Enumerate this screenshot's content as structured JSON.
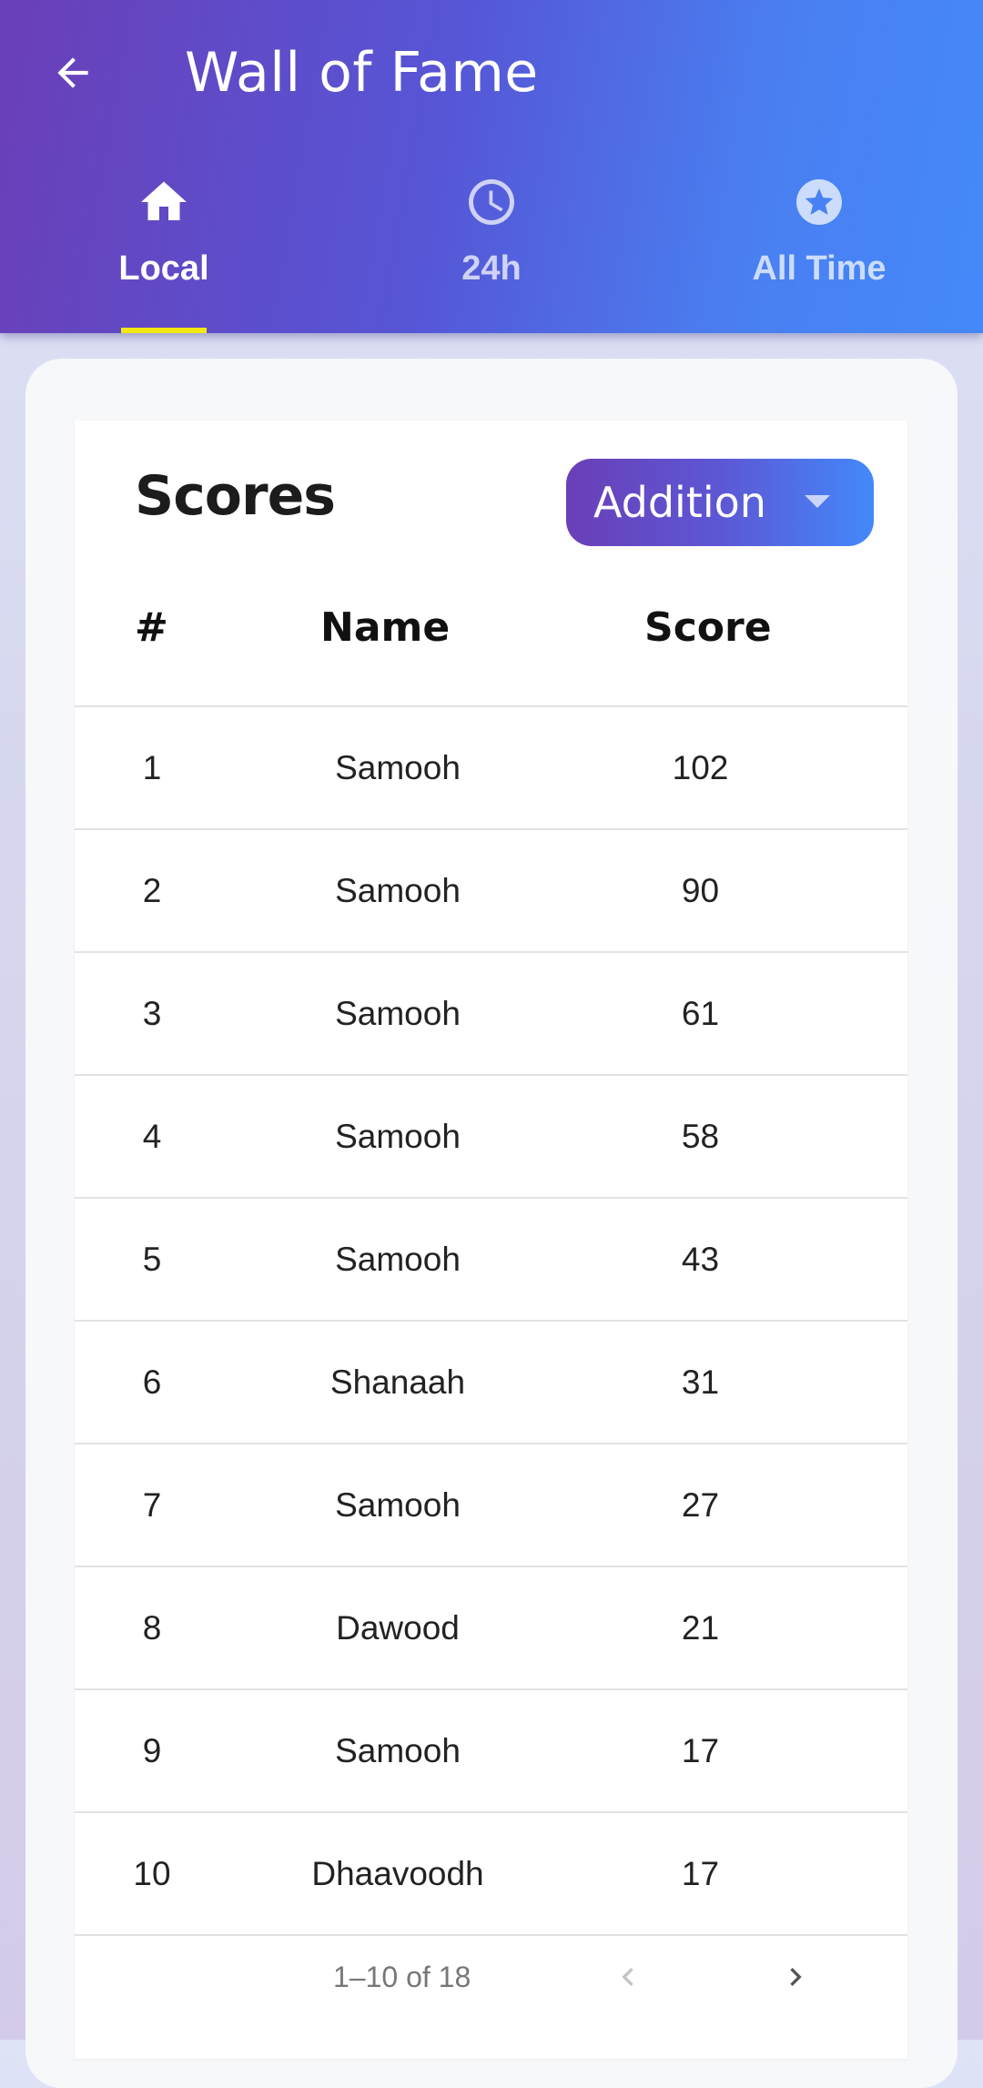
{
  "header": {
    "title": "Wall of Fame",
    "back_icon": "arrow-left-icon"
  },
  "tabs": [
    {
      "label": "Local",
      "icon": "home-icon",
      "active": true
    },
    {
      "label": "24h",
      "icon": "clock-icon",
      "active": false
    },
    {
      "label": "All Time",
      "icon": "star-circle-icon",
      "active": false
    }
  ],
  "scores": {
    "title": "Scores",
    "mode_selected": "Addition",
    "columns": {
      "rank": "#",
      "name": "Name",
      "score": "Score"
    },
    "rows": [
      {
        "rank": "1",
        "name": "Samooh",
        "score": "102"
      },
      {
        "rank": "2",
        "name": "Samooh",
        "score": "90"
      },
      {
        "rank": "3",
        "name": "Samooh",
        "score": "61"
      },
      {
        "rank": "4",
        "name": "Samooh",
        "score": "58"
      },
      {
        "rank": "5",
        "name": "Samooh",
        "score": "43"
      },
      {
        "rank": "6",
        "name": "Shanaah",
        "score": "31"
      },
      {
        "rank": "7",
        "name": "Samooh",
        "score": "27"
      },
      {
        "rank": "8",
        "name": "Dawood",
        "score": "21"
      },
      {
        "rank": "9",
        "name": "Samooh",
        "score": "17"
      },
      {
        "rank": "10",
        "name": "Dhaavoodh",
        "score": "17"
      }
    ],
    "pagination": {
      "range": "1–10 of 18"
    }
  },
  "colors": {
    "header_start": "#6a3fb8",
    "header_end": "#4489fb",
    "tab_indicator": "#f3e814"
  }
}
